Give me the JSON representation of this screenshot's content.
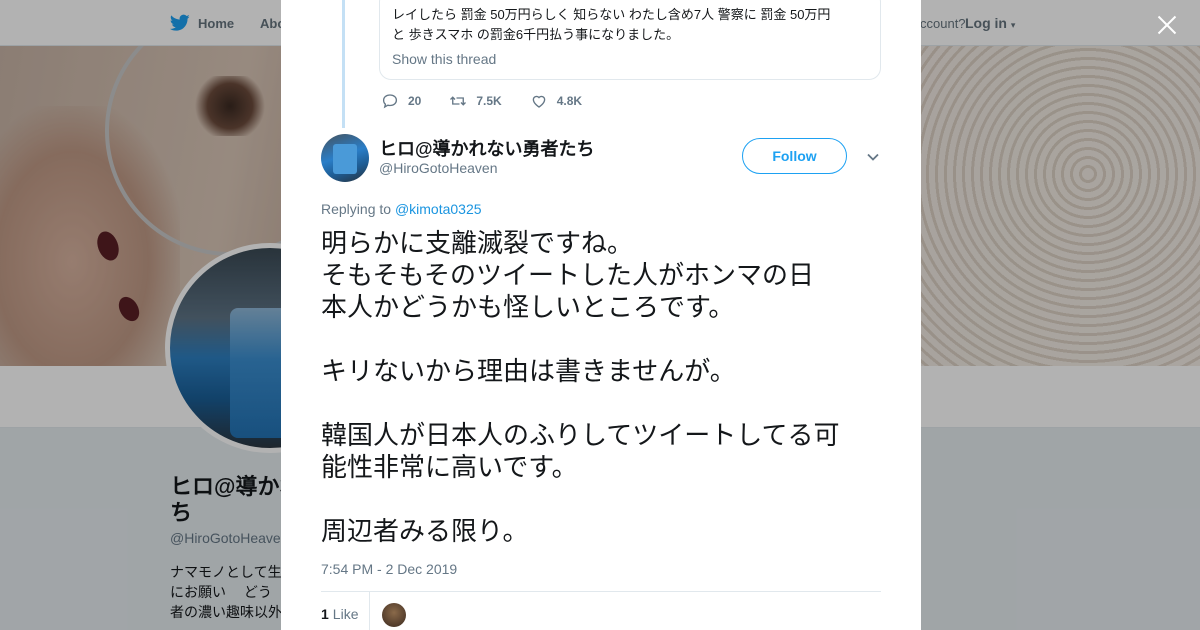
{
  "nav": {
    "home": "Home",
    "about": "Abo",
    "account_prompt": "ccount?",
    "login": "Log in"
  },
  "profile_bg": {
    "name": "ヒロ@導かれ ち",
    "name_line1": "ヒロ@導かれ",
    "name_line2": "ち",
    "handle": "@HiroGotoHeave",
    "bio_lines": [
      "ナマモノとして生",
      "にお願い　 どう",
      "者の濃い趣味以外"
    ]
  },
  "quoted": {
    "text_line1": "レイしたら 罰金 50万円らしく 知らない わたし含め7人 警察に 罰金 50万円",
    "text_line2": "と 歩きスマホ の罰金6千円払う事になりました。",
    "show_thread": "Show this thread",
    "replies": "20",
    "retweets": "7.5K",
    "likes": "4.8K"
  },
  "tweet": {
    "author_name": "ヒロ@導かれない勇者たち",
    "author_handle": "@HiroGotoHeaven",
    "follow_label": "Follow",
    "replying_prefix": "Replying to",
    "replying_mention": "@kimota0325",
    "lines": [
      "明らかに支離滅裂ですね。",
      "そもそもそのツイートした人がホンマの日",
      "本人かどうかも怪しいところです。",
      "",
      "キリないから理由は書きませんが。",
      "",
      "韓国人が日本人のふりしてツイートしてる可",
      "能性非常に高いです。",
      "",
      "周辺者みる限り。"
    ],
    "timestamp": "7:54 PM - 2 Dec 2019",
    "like_count": "1",
    "like_label": "Like"
  },
  "colors": {
    "brand": "#1da1f2",
    "text": "#14171a",
    "muted": "#657786",
    "thread_line": "#c4e0f5"
  }
}
